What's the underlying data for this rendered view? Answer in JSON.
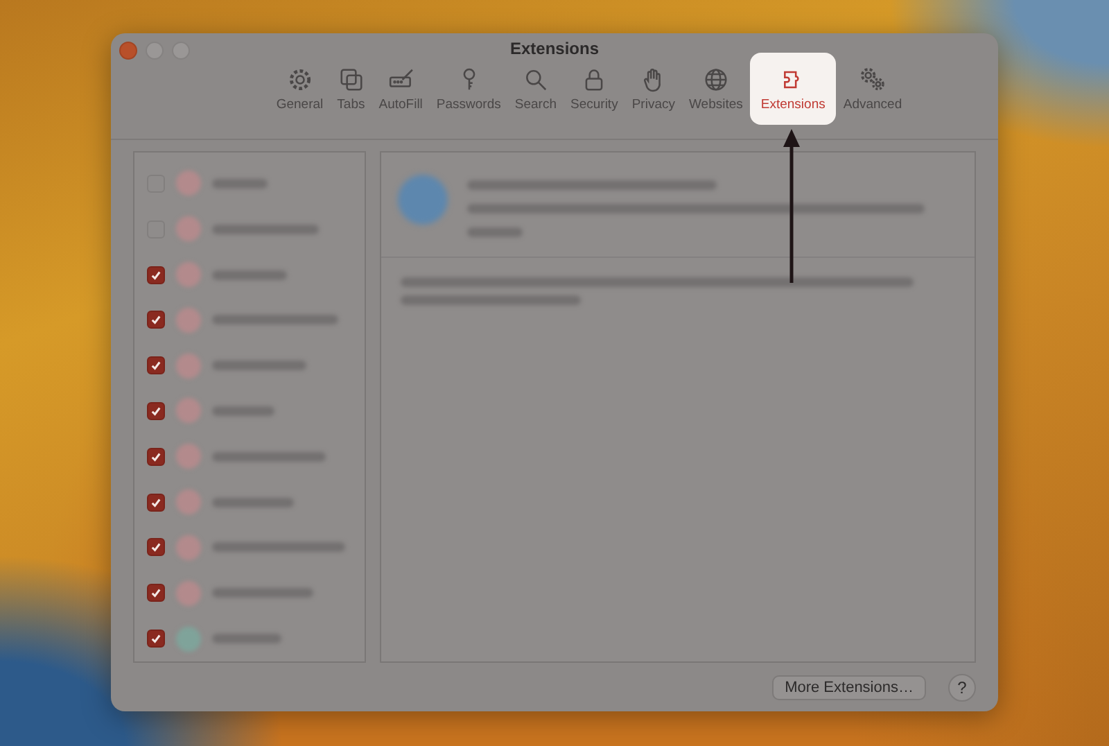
{
  "window": {
    "title": "Extensions"
  },
  "tabs": [
    {
      "label": "General",
      "kind": "gear",
      "selected": false
    },
    {
      "label": "Tabs",
      "kind": "tabs",
      "selected": false
    },
    {
      "label": "AutoFill",
      "kind": "autofill",
      "selected": false
    },
    {
      "label": "Passwords",
      "kind": "key",
      "selected": false
    },
    {
      "label": "Search",
      "kind": "search",
      "selected": false
    },
    {
      "label": "Security",
      "kind": "lock",
      "selected": false
    },
    {
      "label": "Privacy",
      "kind": "hand",
      "selected": false
    },
    {
      "label": "Websites",
      "kind": "globe",
      "selected": false
    },
    {
      "label": "Extensions",
      "kind": "puzzle",
      "selected": true
    },
    {
      "label": "Advanced",
      "kind": "gears",
      "selected": false
    }
  ],
  "extensions": [
    {
      "checked": false,
      "color": "#b38a8c"
    },
    {
      "checked": false,
      "color": "#b38a8c"
    },
    {
      "checked": true,
      "color": "#b38a8c"
    },
    {
      "checked": true,
      "color": "#b38a8c"
    },
    {
      "checked": true,
      "color": "#b38a8c"
    },
    {
      "checked": true,
      "color": "#b38a8c"
    },
    {
      "checked": true,
      "color": "#b38a8c"
    },
    {
      "checked": true,
      "color": "#b38a8c"
    },
    {
      "checked": true,
      "color": "#b38a8c"
    },
    {
      "checked": true,
      "color": "#b38a8c"
    },
    {
      "checked": true,
      "color": "#7fa39a"
    }
  ],
  "buttons": {
    "more": "More Extensions…",
    "help": "?"
  }
}
